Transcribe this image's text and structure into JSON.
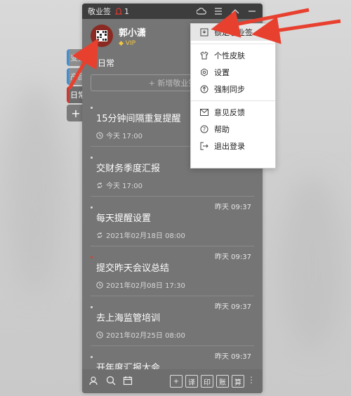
{
  "window": {
    "title": "敬业签",
    "notify_count": "1"
  },
  "user": {
    "name": "郭小潇",
    "vip": "VIP"
  },
  "side_tabs": [
    "变更",
    "产品",
    "日常",
    "+"
  ],
  "section": {
    "title": "日常",
    "new_button": "+ 新增敬业签"
  },
  "items": [
    {
      "when": "",
      "title": "15分钟间隔重复提醒",
      "time": "今天 17:00",
      "icon": "clock-icon",
      "red": false
    },
    {
      "when": "",
      "title": "交财务季度汇报",
      "time": "今天 17:00",
      "icon": "repeat-icon",
      "red": false
    },
    {
      "when": "昨天 09:37",
      "title": "每天提醒设置",
      "time": "2021年02月18日 08:00",
      "icon": "repeat-icon",
      "red": false
    },
    {
      "when": "昨天 09:37",
      "title": "提交昨天会议总结",
      "time": "2021年02月08日 17:30",
      "icon": "clock-icon",
      "red": true
    },
    {
      "when": "昨天 09:37",
      "title": "去上海监管培训",
      "time": "2021年02月25日 08:00",
      "icon": "clock-icon",
      "red": false
    },
    {
      "when": "昨天 09:37",
      "title": "开年度汇报大会",
      "time": "",
      "icon": "",
      "red": false
    }
  ],
  "menu": {
    "items": [
      {
        "label": "锁定敬业签",
        "icon": "lock-icon"
      },
      {
        "label": "个性皮肤",
        "icon": "shirt-icon"
      },
      {
        "label": "设置",
        "icon": "gear-icon"
      },
      {
        "label": "强制同步",
        "icon": "sync-icon"
      },
      {
        "label": "意见反馈",
        "icon": "mail-icon"
      },
      {
        "label": "帮助",
        "icon": "help-icon"
      },
      {
        "label": "退出登录",
        "icon": "logout-icon"
      }
    ]
  },
  "bottom_bar": {
    "buttons": [
      "+",
      "译",
      "印",
      "账",
      "算"
    ]
  },
  "colors": {
    "accent_red": "#e53a30",
    "window_bg": "#757575",
    "titlebar_bg": "#3d3d3d"
  }
}
